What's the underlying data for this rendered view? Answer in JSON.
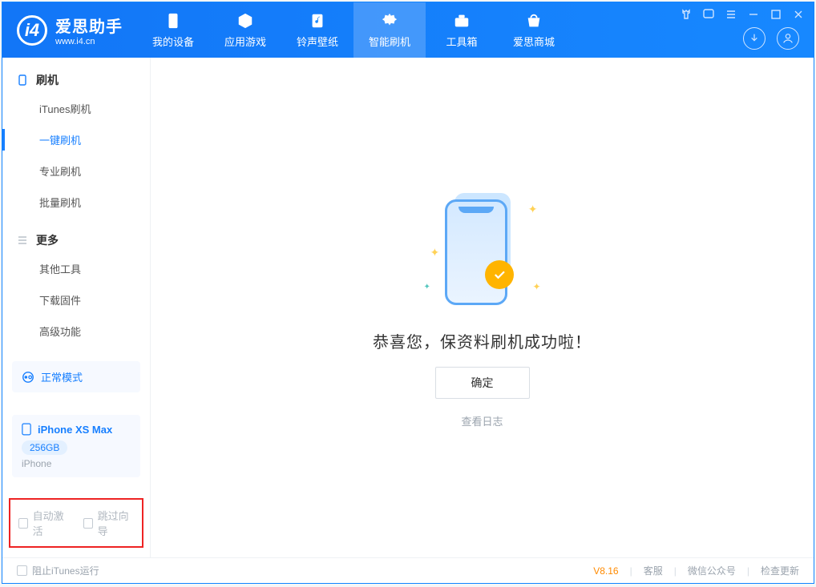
{
  "app": {
    "name": "爱思助手",
    "url": "www.i4.cn"
  },
  "nav": [
    {
      "label": "我的设备",
      "icon": "phone-icon"
    },
    {
      "label": "应用游戏",
      "icon": "cube-icon"
    },
    {
      "label": "铃声壁纸",
      "icon": "music-icon"
    },
    {
      "label": "智能刷机",
      "icon": "gear-icon",
      "active": true
    },
    {
      "label": "工具箱",
      "icon": "toolbox-icon"
    },
    {
      "label": "爱思商城",
      "icon": "shop-icon"
    }
  ],
  "sidebar": {
    "sections": [
      {
        "title": "刷机",
        "items": [
          {
            "label": "iTunes刷机"
          },
          {
            "label": "一键刷机",
            "active": true
          },
          {
            "label": "专业刷机"
          },
          {
            "label": "批量刷机"
          }
        ]
      },
      {
        "title": "更多",
        "items": [
          {
            "label": "其他工具"
          },
          {
            "label": "下载固件"
          },
          {
            "label": "高级功能"
          }
        ]
      }
    ],
    "mode_label": "正常模式",
    "device": {
      "name": "iPhone XS Max",
      "storage": "256GB",
      "model": "iPhone"
    },
    "options": {
      "auto_activate": "自动激活",
      "skip_guide": "跳过向导"
    }
  },
  "main": {
    "result_title": "恭喜您，保资料刷机成功啦！",
    "confirm_label": "确定",
    "view_log_label": "查看日志"
  },
  "footer": {
    "block_itunes": "阻止iTunes运行",
    "version": "V8.16",
    "support": "客服",
    "wechat": "微信公众号",
    "update": "检查更新"
  }
}
